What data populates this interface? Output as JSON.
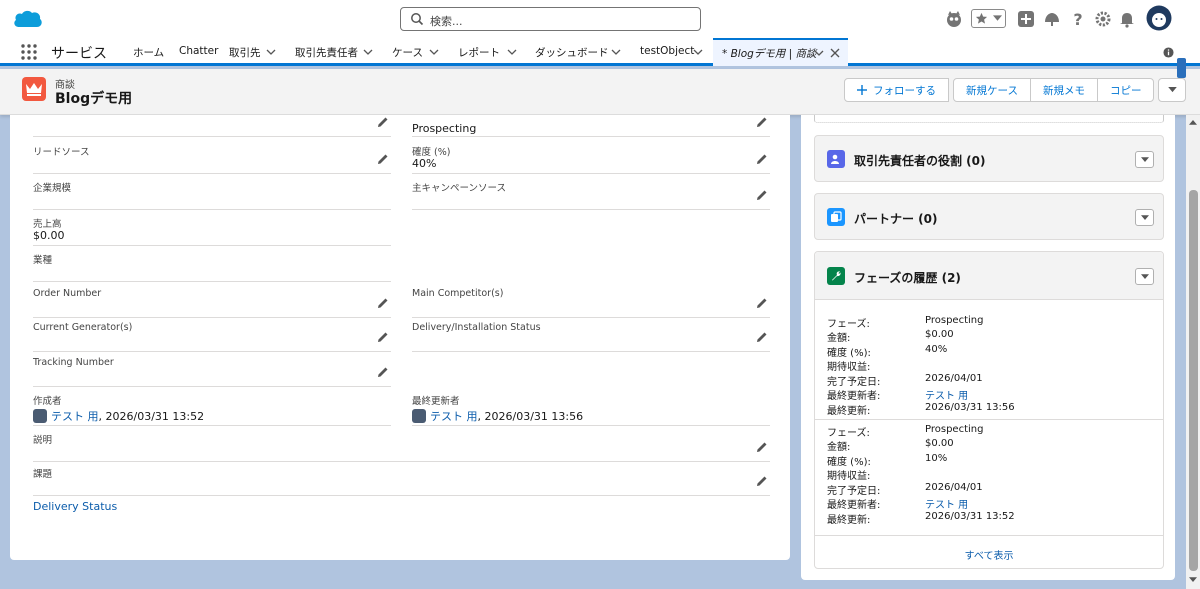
{
  "search": {
    "placeholder": "検索..."
  },
  "nav": {
    "app_name": "サービス",
    "items": [
      {
        "label": "ホーム",
        "has_menu": false
      },
      {
        "label": "Chatter",
        "has_menu": false
      },
      {
        "label": "取引先",
        "has_menu": true
      },
      {
        "label": "取引先責任者",
        "has_menu": true
      },
      {
        "label": "ケース",
        "has_menu": true
      },
      {
        "label": "レポート",
        "has_menu": true
      },
      {
        "label": "ダッシュボード",
        "has_menu": true
      },
      {
        "label": "testObject",
        "has_menu": true
      }
    ],
    "active_tab": "* Blogデモ用 | 商談"
  },
  "record": {
    "type": "商談",
    "name": "Blogデモ用",
    "buttons": {
      "follow": "フォローする",
      "new_case": "新規ケース",
      "new_note": "新規メモ",
      "copy": "コピー"
    }
  },
  "fields": {
    "stage": {
      "value": "Prospecting"
    },
    "lead_source": {
      "label": "リードソース",
      "value": ""
    },
    "probability": {
      "label": "確度 (%)",
      "value": "40%"
    },
    "company_size": {
      "label": "企業規模",
      "value": ""
    },
    "campaign": {
      "label": "主キャンペーンソース",
      "value": ""
    },
    "revenue": {
      "label": "売上高",
      "value": "$0.00"
    },
    "industry": {
      "label": "業種",
      "value": ""
    },
    "order_number": {
      "label": "Order Number",
      "value": ""
    },
    "main_competitor": {
      "label": "Main Competitor(s)",
      "value": ""
    },
    "current_generator": {
      "label": "Current Generator(s)",
      "value": ""
    },
    "delivery_install_status": {
      "label": "Delivery/Installation Status",
      "value": ""
    },
    "tracking_number": {
      "label": "Tracking Number",
      "value": ""
    },
    "created_by": {
      "label": "作成者",
      "user": "テスト 用",
      "date": ", 2026/03/31 13:52"
    },
    "modified_by": {
      "label": "最終更新者",
      "user": "テスト 用",
      "date": ", 2026/03/31 13:56"
    },
    "description": {
      "label": "説明",
      "value": ""
    },
    "subject": {
      "label": "課題",
      "value": ""
    },
    "delivery_status": {
      "label": "Delivery Status"
    }
  },
  "related": {
    "contact_roles": {
      "title": "取引先責任者の役割 (0)"
    },
    "partners": {
      "title": "パートナー (0)"
    },
    "stage_history": {
      "title": "フェーズの履歴 (2)",
      "labels": {
        "stage": "フェーズ:",
        "amount": "金額:",
        "probability": "確度 (%):",
        "expected": "期待収益:",
        "close_date": "完了予定日:",
        "modified_by": "最終更新者:",
        "modified": "最終更新:"
      },
      "entries": [
        {
          "stage": "Prospecting",
          "amount": "$0.00",
          "probability": "40%",
          "expected": "",
          "close_date": "2026/04/01",
          "modified_by": "テスト 用",
          "modified": "2026/03/31 13:56"
        },
        {
          "stage": "Prospecting",
          "amount": "$0.00",
          "probability": "10%",
          "expected": "",
          "close_date": "2026/04/01",
          "modified_by": "テスト 用",
          "modified": "2026/03/31 13:52"
        }
      ],
      "view_all": "すべて表示"
    }
  },
  "colors": {
    "brand": "#0176d3",
    "opportunity_icon": "#f2583f",
    "contact_role_icon": "#5867e8",
    "partner_icon": "#1b96ff",
    "history_icon": "#04844b"
  }
}
